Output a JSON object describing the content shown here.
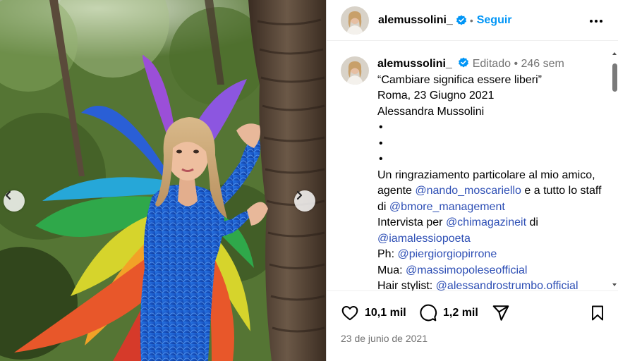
{
  "post": {
    "username": "alemussolini_",
    "follow_label": "Seguir",
    "edited_label": "Editado",
    "age": "246 sem",
    "caption": {
      "quote": "“Cambiare significa essere liberi”",
      "place_date": "Roma, 23 Giugno 2021",
      "signature": "Alessandra Mussolini",
      "bullets": [
        "•",
        "•",
        "•"
      ],
      "thanks_1": "Un ringraziamento particolare al mio amico, agente ",
      "thanks_mention": "@nando_moscariello",
      "thanks_2": " e a tutto lo staff di ",
      "staff_mention": "@bmore_management",
      "interview_label": "Intervista per ",
      "interview_mention": "@chimagazineit",
      "interview_di": " di",
      "journalist_mention": "@iamalessiopoeta",
      "ph_label": "Ph: ",
      "ph_mention": "@piergiorgiopirrone",
      "mua_label": "Mua: ",
      "mua_mention": "@massimopoleseofficial",
      "hair_label": "Hair stylist: ",
      "hair_mention": "@alessandrostrumbo.official"
    },
    "likes": "10,1 mil",
    "comments": "1,2 mil",
    "date": "23 de junio de 2021"
  },
  "icons": {
    "verified": "verified-badge-icon",
    "more": "more-options-icon",
    "like": "heart-icon",
    "comment": "comment-bubble-icon",
    "share": "paper-plane-icon",
    "save": "bookmark-icon",
    "prev": "chevron-left-icon",
    "next": "chevron-right-icon"
  },
  "colors": {
    "link": "#2e4fb5",
    "follow": "#0095f6",
    "verified": "#0095f6",
    "muted": "#737373",
    "costume": "#1f5fd0"
  }
}
